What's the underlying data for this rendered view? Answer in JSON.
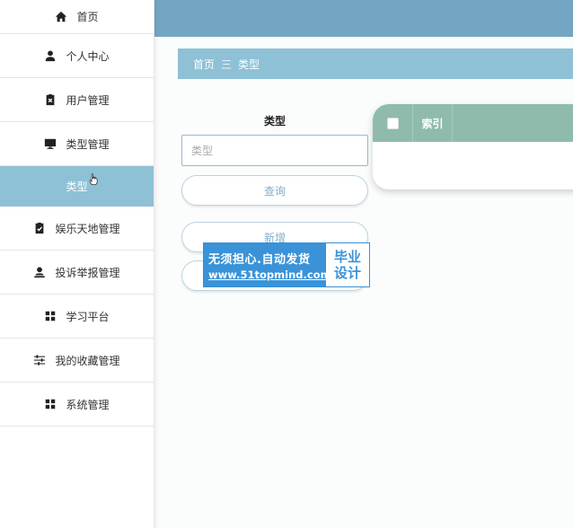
{
  "sidebar": {
    "items": [
      {
        "label": "首页",
        "icon": "home-icon"
      },
      {
        "label": "个人中心",
        "icon": "person-icon"
      },
      {
        "label": "用户管理",
        "icon": "clipboard-x-icon"
      },
      {
        "label": "类型管理",
        "icon": "monitor-icon"
      },
      {
        "label": "类型",
        "icon": ""
      },
      {
        "label": "娱乐天地管理",
        "icon": "clipboard-check-icon"
      },
      {
        "label": "投诉举报管理",
        "icon": "user-badge-icon"
      },
      {
        "label": "学习平台",
        "icon": "grid-icon"
      },
      {
        "label": "我的收藏管理",
        "icon": "sliders-icon"
      },
      {
        "label": "系统管理",
        "icon": "grid-icon"
      }
    ]
  },
  "breadcrumb": {
    "home": "首页",
    "separator": "三",
    "current": "类型"
  },
  "search": {
    "label": "类型",
    "placeholder": "类型"
  },
  "buttons": {
    "query": "查询",
    "add": "新增",
    "delete": ""
  },
  "watermark": {
    "line1": "无须担心.自动发货",
    "line2": "www.51topmind.com",
    "right1": "毕业",
    "right2": "设计"
  },
  "table": {
    "headers": [
      "索引"
    ]
  },
  "colors": {
    "sidebar_active": "#8ec1d6",
    "topbar": "#73a6c4",
    "table_header": "#8fbbad",
    "button_text": "#7fb0c9"
  }
}
